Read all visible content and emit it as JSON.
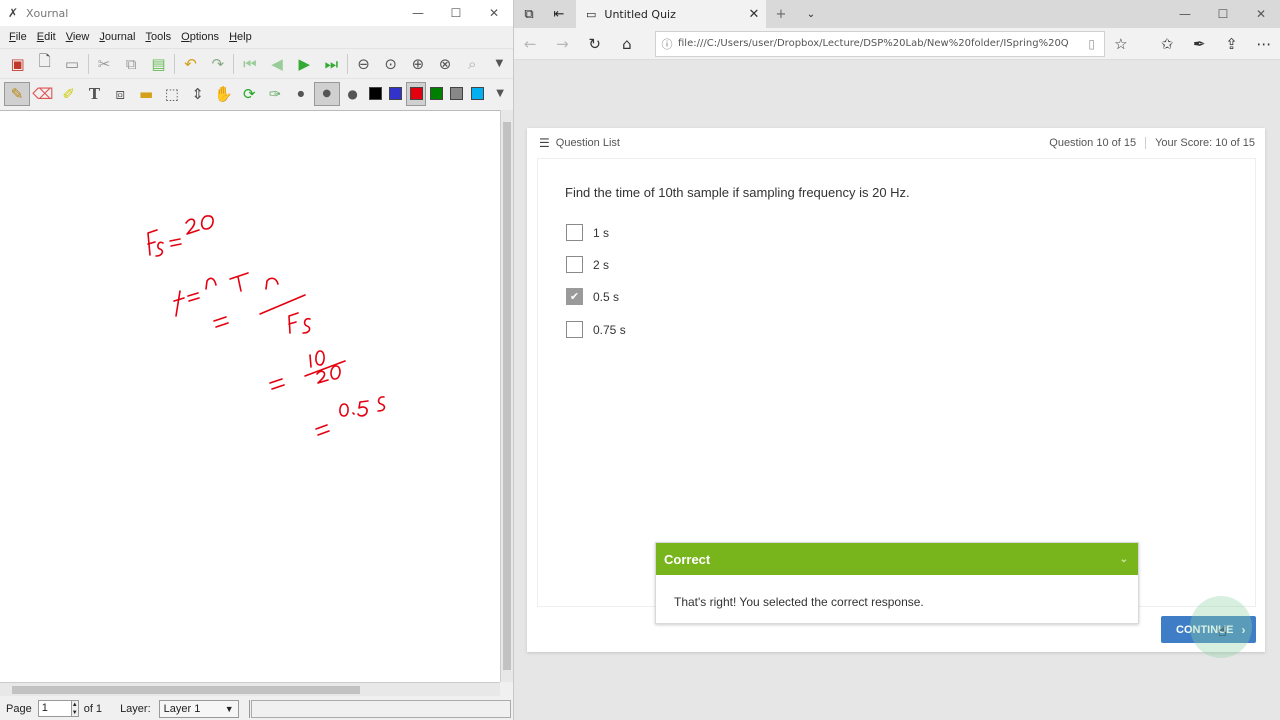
{
  "xournal": {
    "title": "Xournal",
    "menu": [
      "File",
      "Edit",
      "View",
      "Journal",
      "Tools",
      "Options",
      "Help"
    ],
    "status": {
      "page_label": "Page",
      "page_value": "1",
      "of_label": "of 1",
      "layer_label": "Layer:",
      "layer_value": "Layer 1"
    },
    "colors": {
      "ink": "#e3000f"
    },
    "handwriting": [
      "Fs = 20",
      "t = nT",
      "= n / Fs",
      "= 10 / 20",
      "= 0.5s"
    ]
  },
  "edge": {
    "tab_title": "Untitled Quiz",
    "address": "file:///C:/Users/user/Dropbox/Lecture/DSP%20Lab/New%20folder/ISpring%20Q"
  },
  "quiz": {
    "question_list_label": "Question List",
    "progress": "Question 10 of 15",
    "score": "Your Score: 10 of 15",
    "question": "Find the time of 10th sample if sampling frequency is 20 Hz.",
    "answers": [
      {
        "label": "1 s",
        "checked": false
      },
      {
        "label": "2 s",
        "checked": false
      },
      {
        "label": "0.5 s",
        "checked": true
      },
      {
        "label": "0.75 s",
        "checked": false
      }
    ],
    "feedback_title": "Correct",
    "feedback_text": "That's right! You selected the correct response.",
    "continue_label": "CONTINUE",
    "colors": {
      "correct_green": "#78b41c",
      "button_blue": "#3f7ec6"
    }
  }
}
